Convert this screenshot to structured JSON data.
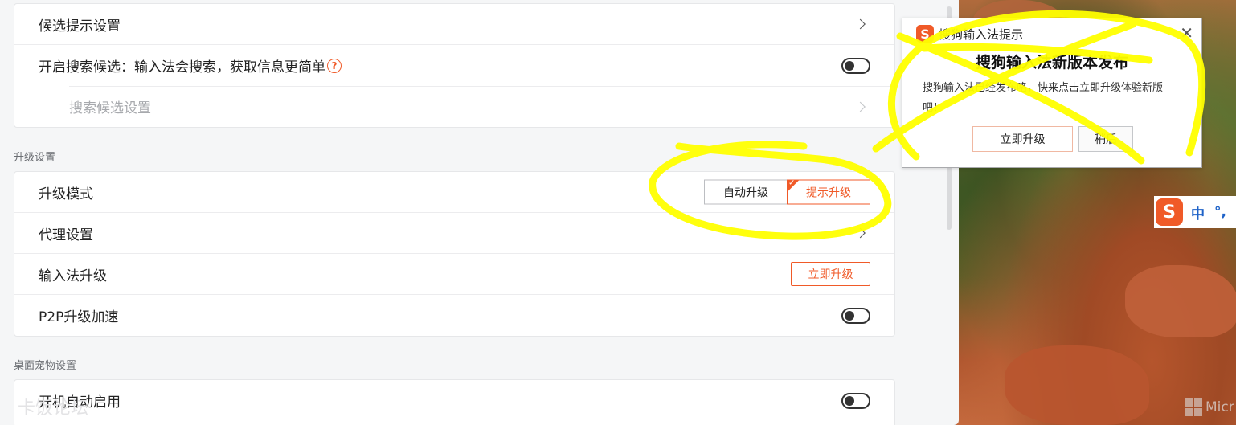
{
  "settings": {
    "candidate_card": {
      "rows": [
        {
          "label": "候选提示设置"
        },
        {
          "label": "开启搜索候选：输入法会搜索，获取信息更简单"
        },
        {
          "label": "搜索候选设置"
        }
      ],
      "help_glyph": "?"
    },
    "upgrade_section": {
      "title": "升级设置",
      "mode_label": "升级模式",
      "mode_options": [
        "自动升级",
        "提示升级"
      ],
      "mode_selected": "提示升级",
      "proxy_label": "代理设置",
      "ime_upgrade_label": "输入法升级",
      "ime_upgrade_button": "立即升级",
      "p2p_label": "P2P升级加速"
    },
    "pet_section": {
      "title": "桌面宠物设置",
      "autostart_label": "开机自动启用"
    },
    "watermark": "卡饭论坛"
  },
  "popup": {
    "app_name": "搜狗输入法提示",
    "close_glyph": "✕",
    "heading": "搜狗输入法新版本发布",
    "body": "搜狗输入法已经发布咯，快来点击立即升级体验新版吧！",
    "primary_button": "立即升级",
    "secondary_button": "稍后"
  },
  "ime_bar": {
    "logo_glyph": "S",
    "mode": "中",
    "punct": "°,"
  },
  "desktop": {
    "ms_text": "Micr"
  },
  "colors": {
    "accent": "#f05a28",
    "annotation": "#ffff00",
    "ime_blue": "#1e62c8"
  }
}
